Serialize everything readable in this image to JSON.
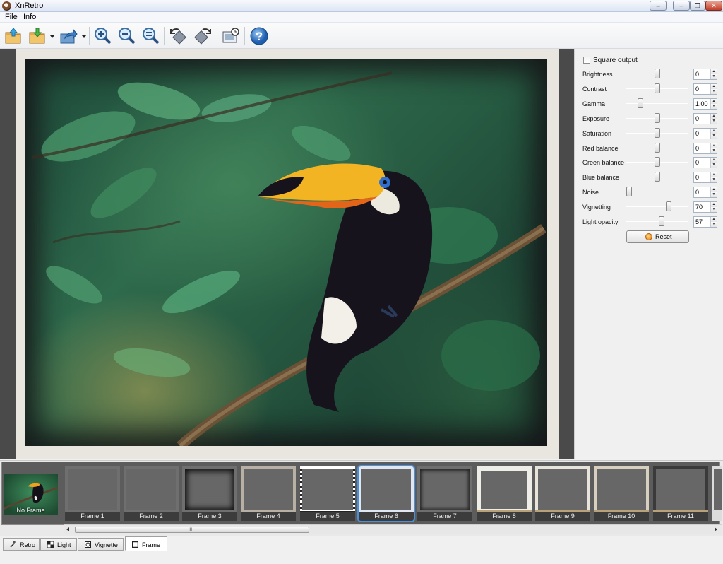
{
  "window": {
    "title": "XnRetro",
    "controls": [
      "⇔",
      "–",
      "❐",
      "✕"
    ]
  },
  "menu": {
    "items": [
      "File",
      "Info"
    ]
  },
  "toolbar": {
    "buttons": [
      "open-icon",
      "save-icon",
      "share-icon",
      "zoom-in-icon",
      "zoom-out-icon",
      "zoom-fit-icon",
      "rotate-left-icon",
      "rotate-right-icon",
      "fullscreen-icon",
      "help-icon"
    ],
    "help_glyph": "?"
  },
  "panel": {
    "square_output": {
      "label": "Square output",
      "checked": false
    },
    "sliders": [
      {
        "label": "Brightness",
        "value": "0",
        "position": 0.5
      },
      {
        "label": "Contrast",
        "value": "0",
        "position": 0.5
      },
      {
        "label": "Gamma",
        "value": "1,00",
        "position": 0.2
      },
      {
        "label": "Exposure",
        "value": "0",
        "position": 0.5
      },
      {
        "label": "Saturation",
        "value": "0",
        "position": 0.5
      },
      {
        "label": "Red balance",
        "value": "0",
        "position": 0.5
      },
      {
        "label": "Green balance",
        "value": "0",
        "position": 0.5
      },
      {
        "label": "Blue balance",
        "value": "0",
        "position": 0.5
      },
      {
        "label": "Noise",
        "value": "0",
        "position": 0.0
      },
      {
        "label": "Vignetting",
        "value": "70",
        "position": 0.7
      },
      {
        "label": "Light opacity",
        "value": "57",
        "position": 0.57
      }
    ],
    "reset_label": "Reset"
  },
  "filmstrip": {
    "no_frame": "No Frame",
    "frames": [
      "Frame 1",
      "Frame 2",
      "Frame 3",
      "Frame 4",
      "Frame 5",
      "Frame 6",
      "Frame 7",
      "Frame 8",
      "Frame 9",
      "Frame 10",
      "Frame 11"
    ],
    "selected": "Frame 6",
    "scroll_grip": "III"
  },
  "tabs": [
    {
      "label": "Retro",
      "icon": "wand-icon"
    },
    {
      "label": "Light",
      "icon": "light-icon"
    },
    {
      "label": "Vignette",
      "icon": "vignette-icon"
    },
    {
      "label": "Frame",
      "icon": "frame-icon",
      "active": true
    }
  ],
  "colors": {
    "accent": "#4a8fd8",
    "canvas_bg": "#4a4a4a"
  }
}
